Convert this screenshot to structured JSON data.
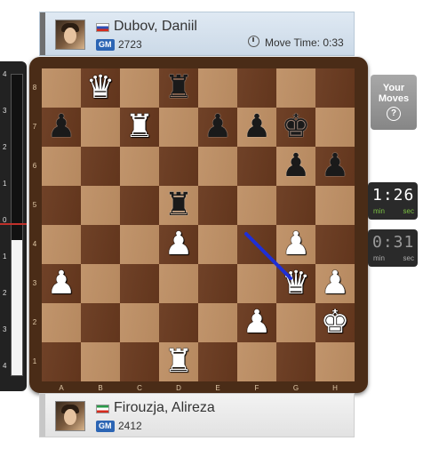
{
  "top_player": {
    "name": "Dubov, Daniil",
    "title": "GM",
    "rating": "2723",
    "move_time_label": "Move Time: 0:33",
    "flag": "russia-flag"
  },
  "bottom_player": {
    "name": "Firouzja, Alireza",
    "title": "GM",
    "rating": "2412",
    "flag": "iran-flag"
  },
  "your_moves": {
    "label_line1": "Your",
    "label_line2": "Moves",
    "help_glyph": "?"
  },
  "clocks": {
    "top": {
      "time": "1:26",
      "min": "min",
      "sec": "sec"
    },
    "bottom": {
      "time": "0:31",
      "min": "min",
      "sec": "sec"
    }
  },
  "eval_bar": {
    "ticks": [
      "4",
      "3",
      "2",
      "1",
      "0",
      "1",
      "2",
      "3",
      "4"
    ],
    "white_fill_fraction": 0.45,
    "zero_color": "#c0302a"
  },
  "board": {
    "files": [
      "A",
      "B",
      "C",
      "D",
      "E",
      "F",
      "G",
      "H"
    ],
    "ranks": [
      "8",
      "7",
      "6",
      "5",
      "4",
      "3",
      "2",
      "1"
    ],
    "pieces": [
      {
        "square": "b8",
        "piece": "queen",
        "color": "white",
        "glyph": "♛"
      },
      {
        "square": "d8",
        "piece": "rook",
        "color": "black",
        "glyph": "♜"
      },
      {
        "square": "a7",
        "piece": "pawn",
        "color": "black",
        "glyph": "♟"
      },
      {
        "square": "c7",
        "piece": "rook",
        "color": "white",
        "glyph": "♜"
      },
      {
        "square": "e7",
        "piece": "pawn",
        "color": "black",
        "glyph": "♟"
      },
      {
        "square": "f7",
        "piece": "pawn",
        "color": "black",
        "glyph": "♟"
      },
      {
        "square": "g7",
        "piece": "king",
        "color": "black",
        "glyph": "♚"
      },
      {
        "square": "g6",
        "piece": "pawn",
        "color": "black",
        "glyph": "♟"
      },
      {
        "square": "h6",
        "piece": "pawn",
        "color": "black",
        "glyph": "♟"
      },
      {
        "square": "d5",
        "piece": "rook",
        "color": "black",
        "glyph": "♜"
      },
      {
        "square": "d4",
        "piece": "pawn",
        "color": "white",
        "glyph": "♟"
      },
      {
        "square": "g4",
        "piece": "pawn",
        "color": "white",
        "glyph": "♟"
      },
      {
        "square": "a3",
        "piece": "pawn",
        "color": "white",
        "glyph": "♟"
      },
      {
        "square": "g3",
        "piece": "queen",
        "color": "white",
        "glyph": "♛"
      },
      {
        "square": "h3",
        "piece": "pawn",
        "color": "white",
        "glyph": "♟"
      },
      {
        "square": "f2",
        "piece": "pawn",
        "color": "white",
        "glyph": "♟"
      },
      {
        "square": "h2",
        "piece": "king",
        "color": "white",
        "glyph": "♚"
      },
      {
        "square": "d1",
        "piece": "rook",
        "color": "white",
        "glyph": "♜"
      }
    ],
    "last_move_arrow": {
      "from": "f4",
      "to": "g3",
      "color": "#1f2fd6"
    },
    "light_square_color": "#bd8e63",
    "dark_square_color": "#6a3a1f"
  }
}
